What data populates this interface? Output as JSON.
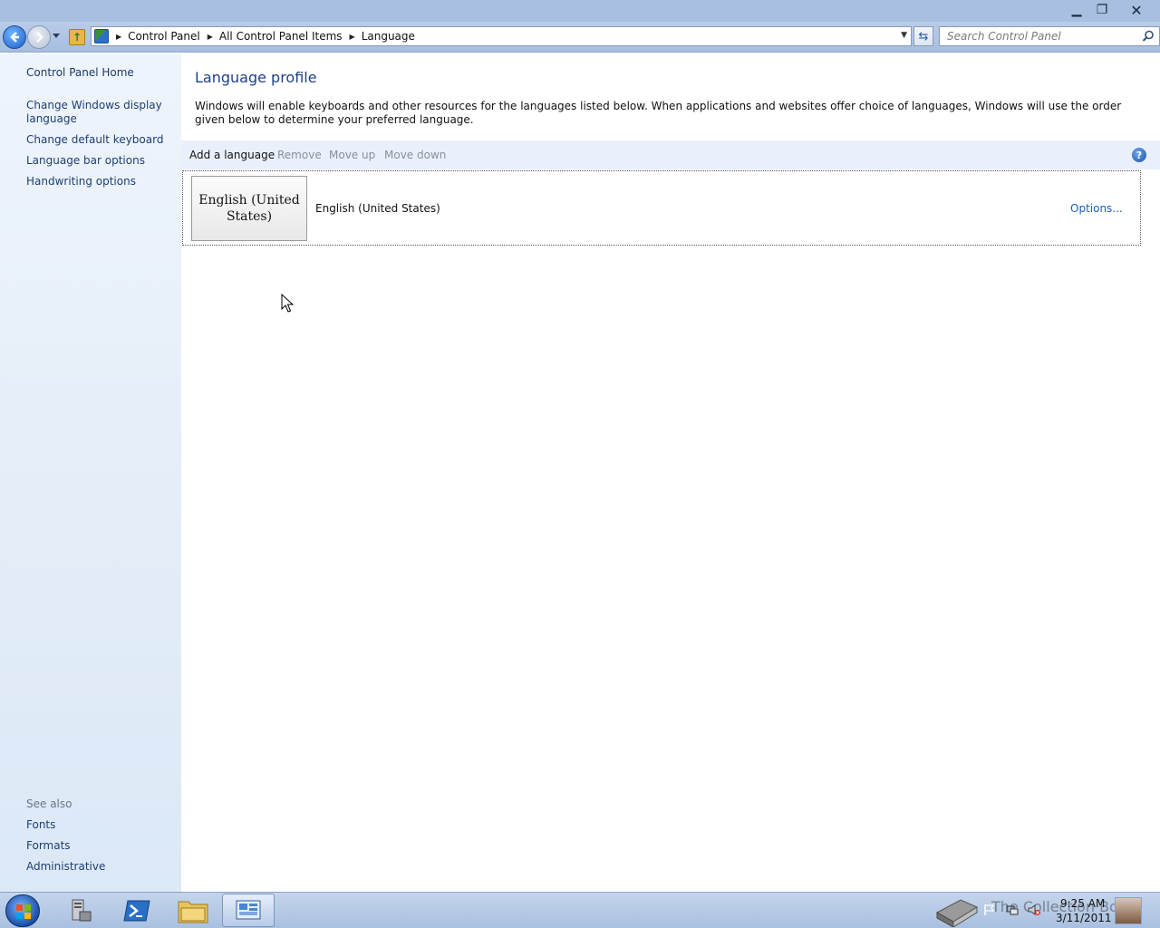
{
  "window": {
    "minimize_label": "▁",
    "maximize_label": "❐",
    "close_label": "✕"
  },
  "address_bar": {
    "breadcrumbs": [
      "Control Panel",
      "All Control Panel Items",
      "Language"
    ],
    "icon": "control-panel-icon"
  },
  "search": {
    "placeholder": "Search Control Panel"
  },
  "sidebar": {
    "home": "Control Panel Home",
    "links": [
      "Change Windows display language",
      "Change default keyboard",
      "Language bar options",
      "Handwriting options"
    ],
    "see_also_heading": "See also",
    "see_also": [
      "Fonts",
      "Formats",
      "Administrative"
    ]
  },
  "main": {
    "title": "Language profile",
    "description": "Windows will enable keyboards and other resources for the languages listed below. When applications and websites offer choice of languages, Windows will use the order given below to determine your preferred language.",
    "toolbar": {
      "add": "Add a language",
      "remove": "Remove",
      "move_up": "Move up",
      "move_down": "Move down"
    },
    "languages": [
      {
        "tile_text": "English (United States)",
        "name": "English (United States)",
        "options_label": "Options..."
      }
    ]
  },
  "taskbar": {
    "apps": [
      "server-manager-icon",
      "powershell-icon",
      "explorer-icon",
      "control-panel-icon"
    ],
    "clock_time": "9:25 AM",
    "clock_date": "3/11/2011",
    "watermark": "The Collection Book"
  },
  "colors": {
    "title_bar": "#a8bfe0",
    "link": "#1e3f73",
    "heading": "#1e3f8a",
    "toolbar_bg": "#e9f0fb",
    "disabled_text": "#8a8f98"
  }
}
